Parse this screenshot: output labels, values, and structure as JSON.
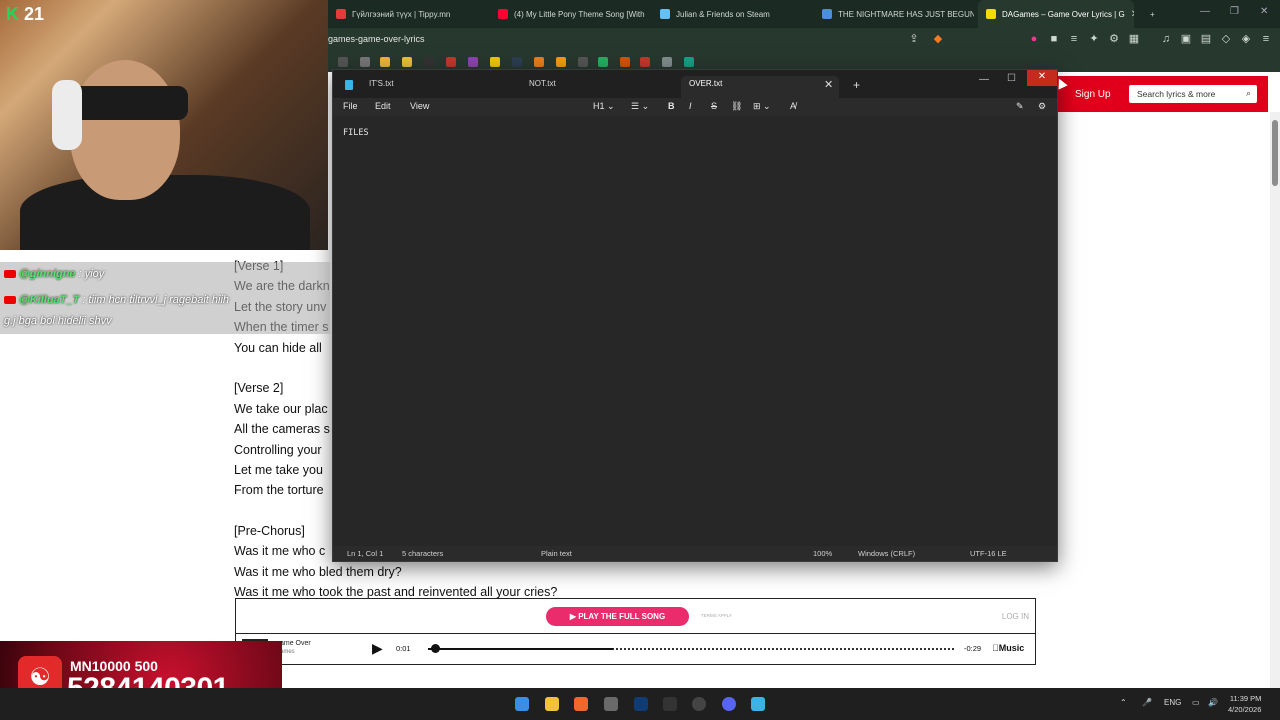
{
  "browser": {
    "tabs": [
      {
        "title": "Гүйлгээний түүх | Tippy.mn",
        "color": "#e23b3b"
      },
      {
        "title": "(4) My Little Pony Theme Song [With",
        "color": "#ff0033"
      },
      {
        "title": "Julian & Friends on Steam",
        "color": "#66c0f4"
      },
      {
        "title": "THE NIGHTMARE HAS JUST BEGUN",
        "color": "#4a90d9"
      },
      {
        "title": "DAGames – Game Over Lyrics | G",
        "color": "#f5d90a"
      }
    ],
    "url": "games-game-over-lyrics",
    "new_tab": "+"
  },
  "site": {
    "signup": "Sign Up",
    "search_placeholder": "Search lyrics & more",
    "lyrics": [
      "[Verse 1]",
      "We are the darkn",
      "Let the story unv",
      "When the timer s",
      "You can hide all",
      "",
      "[Verse 2]",
      "We take our plac",
      "All the cameras s",
      "Controlling your",
      "Let me take you",
      "From the torture",
      "",
      "[Pre-Chorus]",
      "Was it me who c",
      "Was it me who bled them dry?",
      "Was it me who took the past and reinvented all your cries?"
    ]
  },
  "player": {
    "play_full": "▶  PLAY THE FULL SONG",
    "terms": "TERMS APPLY",
    "login": "LOG IN",
    "title": "ame Over",
    "artist": "ames",
    "time_current": "0:01",
    "time_left": "-0:29",
    "service": "Music",
    "progress": 0.35
  },
  "notepad": {
    "tabs": [
      {
        "label": "IT'S.txt"
      },
      {
        "label": "NOT.txt"
      },
      {
        "label": "OVER.txt"
      }
    ],
    "menu": [
      "File",
      "Edit",
      "View"
    ],
    "heading_tool": "H1",
    "content": "FILES",
    "status": {
      "position": "Ln 1, Col 1",
      "chars": "5 characters",
      "format": "Plain text",
      "zoom": "100%",
      "eol": "Windows (CRLF)",
      "encoding": "UTF-16 LE"
    }
  },
  "stream": {
    "kick_logo": "K",
    "viewer_count": "21",
    "chat": [
      {
        "user": "@ginnigne",
        "text": " : yioy"
      },
      {
        "user": "@KilluaT_T",
        "text": " : tiim hcn tiltrvvl_j ragebait hiih"
      },
      {
        "user": "",
        "text": "g.j bga bol hidelii shvv"
      }
    ],
    "donation_top": "MN10000  500",
    "donation_num": "5284140301"
  },
  "taskbar": {
    "lang": "ENG",
    "time": "11:39 PM",
    "date": "4/20/2026"
  }
}
